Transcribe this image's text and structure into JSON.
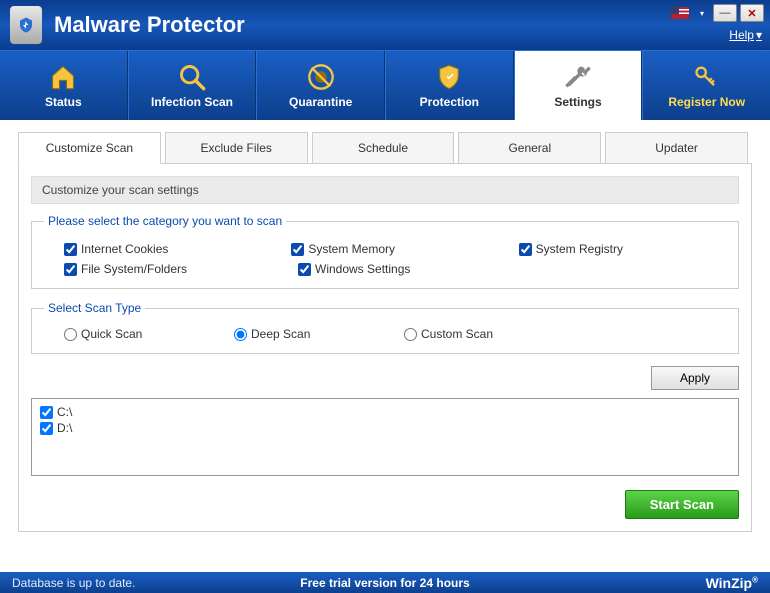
{
  "titlebar": {
    "title": "Malware Protector",
    "help_label": "Help",
    "help_arrow": "▾"
  },
  "nav": {
    "items": [
      {
        "label": "Status"
      },
      {
        "label": "Infection Scan"
      },
      {
        "label": "Quarantine"
      },
      {
        "label": "Protection"
      },
      {
        "label": "Settings"
      },
      {
        "label": "Register Now"
      }
    ]
  },
  "subtabs": [
    {
      "label": "Customize Scan"
    },
    {
      "label": "Exclude Files"
    },
    {
      "label": "Schedule"
    },
    {
      "label": "General"
    },
    {
      "label": "Updater"
    }
  ],
  "section_header": "Customize your scan settings",
  "category": {
    "legend": "Please select the category you want to scan",
    "items": [
      {
        "label": "Internet Cookies",
        "checked": true
      },
      {
        "label": "System Memory",
        "checked": true
      },
      {
        "label": "System Registry",
        "checked": true
      },
      {
        "label": "File System/Folders",
        "checked": true
      },
      {
        "label": "Windows Settings",
        "checked": true
      }
    ]
  },
  "scantype": {
    "legend": "Select Scan Type",
    "items": [
      {
        "label": "Quick Scan",
        "checked": false
      },
      {
        "label": "Deep Scan",
        "checked": true
      },
      {
        "label": "Custom Scan",
        "checked": false
      }
    ]
  },
  "apply_label": "Apply",
  "drives": [
    {
      "label": "C:\\",
      "checked": true
    },
    {
      "label": "D:\\",
      "checked": true
    }
  ],
  "start_label": "Start Scan",
  "statusbar": {
    "left": "Database is up to date.",
    "center": "Free trial version for 24 hours",
    "brand": "WinZip",
    "reg": "®"
  }
}
